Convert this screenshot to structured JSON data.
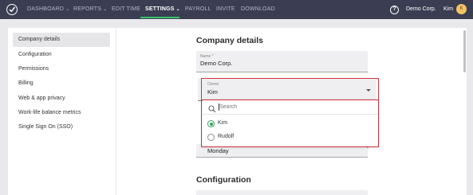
{
  "nav": {
    "items": [
      {
        "label": "DASHBOARD",
        "chevron": true,
        "active": false
      },
      {
        "label": "REPORTS",
        "chevron": true,
        "active": false
      },
      {
        "label": "EDIT TIME",
        "chevron": false,
        "active": false
      },
      {
        "label": "SETTINGS",
        "chevron": true,
        "active": true
      },
      {
        "label": "PAYROLL",
        "chevron": false,
        "active": false
      },
      {
        "label": "INVITE",
        "chevron": false,
        "active": false
      },
      {
        "label": "DOWNLOAD",
        "chevron": false,
        "active": false
      }
    ],
    "help_icon": "question-circle-icon",
    "help_glyph": "?",
    "company": "Demo Corp.",
    "username": "Kim",
    "avatar_initial": "K",
    "accent_color": "#35c16a",
    "background_color": "#3b3e52"
  },
  "sidebar": {
    "items": [
      {
        "label": "Company details",
        "active": true
      },
      {
        "label": "Configuration",
        "active": false
      },
      {
        "label": "Permissions",
        "active": false
      },
      {
        "label": "Billing",
        "active": false
      },
      {
        "label": "Web & app privacy",
        "active": false
      },
      {
        "label": "Work-life balance metrics",
        "active": false
      },
      {
        "label": "Single Sign On (SSO)",
        "active": false
      }
    ]
  },
  "company_details": {
    "title": "Company details",
    "name_field": {
      "label": "Name *",
      "value": "Demo Corp."
    },
    "owner_field": {
      "label": "Owner",
      "value": "Kim"
    },
    "week_start_field": {
      "value": "Monday"
    }
  },
  "owner_dropdown": {
    "search_placeholder": "Search",
    "search_value": "",
    "options": [
      {
        "label": "Kim",
        "selected": true
      },
      {
        "label": "Rudolf",
        "selected": false
      }
    ],
    "selected_color": "#35a35a",
    "highlight_color": "#d1303a"
  },
  "configuration": {
    "title": "Configuration"
  }
}
